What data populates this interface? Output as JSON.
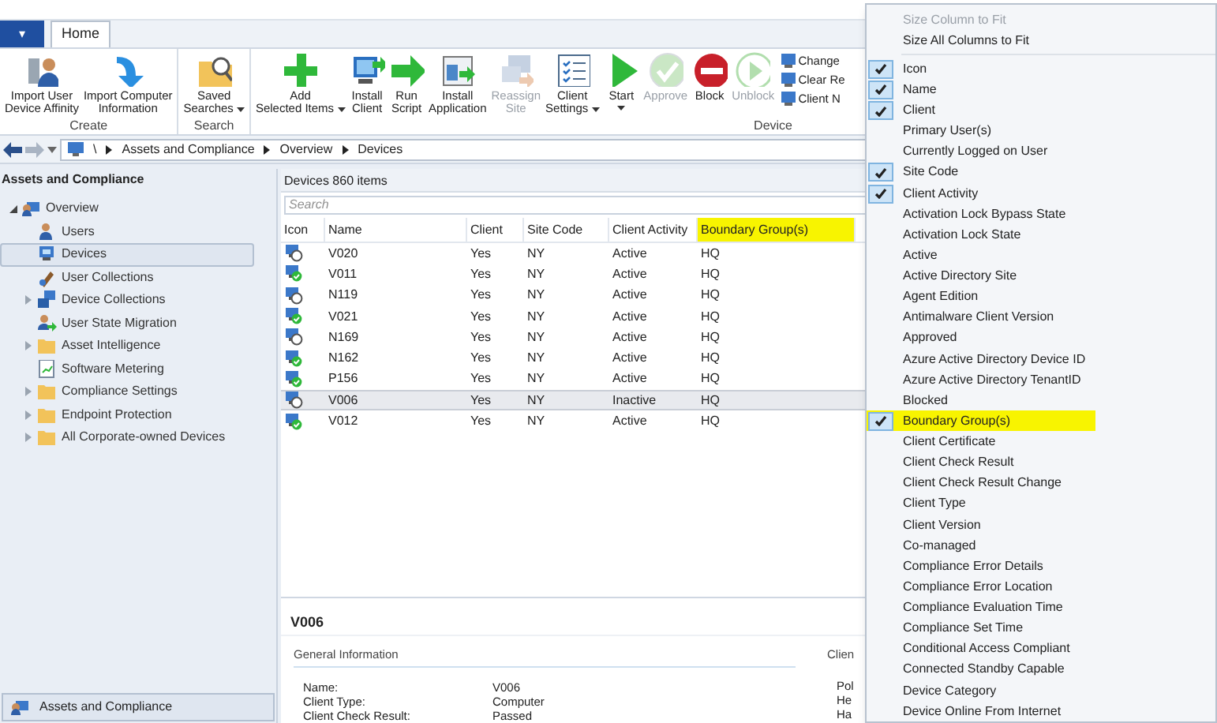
{
  "ribbon": {
    "menu_button": "▾",
    "tabs": [
      {
        "label": "Home",
        "selected": true
      }
    ],
    "groups": [
      {
        "label": "Create",
        "buttons": [
          {
            "kind": "affinity",
            "label": "Import User\nDevice Affinity",
            "disabled": false,
            "dropdown": false
          },
          {
            "kind": "import",
            "label": "Import Computer\nInformation",
            "disabled": false,
            "dropdown": false
          }
        ]
      },
      {
        "label": "Search",
        "buttons": [
          {
            "kind": "search",
            "label": "Saved\nSearches",
            "disabled": false,
            "dropdown": true
          }
        ]
      },
      {
        "label": "Device",
        "buttons": [
          {
            "kind": "add",
            "label": "Add\nSelected Items",
            "disabled": false,
            "dropdown": true
          },
          {
            "kind": "install",
            "label": "Install\nClient",
            "disabled": false,
            "dropdown": false
          },
          {
            "kind": "run",
            "label": "Run\nScript",
            "disabled": false,
            "dropdown": false
          },
          {
            "kind": "app",
            "label": "Install\nApplication",
            "disabled": false,
            "dropdown": false
          },
          {
            "kind": "reassign",
            "label": "Reassign\nSite",
            "disabled": true,
            "dropdown": false
          },
          {
            "kind": "settings",
            "label": "Client\nSettings",
            "disabled": false,
            "dropdown": true
          },
          {
            "kind": "start",
            "label": "Start",
            "disabled": false,
            "dropdown": true
          },
          {
            "kind": "approve",
            "label": "Approve",
            "disabled": true,
            "dropdown": false
          },
          {
            "kind": "block",
            "label": "Block",
            "disabled": false,
            "dropdown": false
          },
          {
            "kind": "unblock",
            "label": "Unblock",
            "disabled": true,
            "dropdown": false
          }
        ],
        "small_buttons": [
          "Change",
          "Clear Re",
          "Client N"
        ]
      }
    ]
  },
  "address_bar": {
    "path": [
      "\\",
      "Assets and Compliance",
      "Overview",
      "Devices"
    ]
  },
  "navigation": {
    "title": "Assets and Compliance",
    "tree": [
      {
        "label": "Overview",
        "kind": "overview",
        "expanded": true,
        "selected": false,
        "children": [
          {
            "label": "Users",
            "kind": "user",
            "selected": false
          },
          {
            "label": "Devices",
            "kind": "device",
            "selected": true
          },
          {
            "label": "User Collections",
            "kind": "user-collection",
            "selected": false
          },
          {
            "label": "Device Collections",
            "kind": "device-collection",
            "expanded": false,
            "selected": false
          },
          {
            "label": "User State Migration",
            "kind": "migration",
            "selected": false
          },
          {
            "label": "Asset Intelligence",
            "kind": "folder",
            "expanded": false,
            "selected": false
          },
          {
            "label": "Software Metering",
            "kind": "metering",
            "selected": false
          },
          {
            "label": "Compliance Settings",
            "kind": "folder",
            "expanded": false,
            "selected": false
          },
          {
            "label": "Endpoint Protection",
            "kind": "folder",
            "expanded": false,
            "selected": false
          },
          {
            "label": "All Corporate-owned Devices",
            "kind": "folder",
            "expanded": false,
            "selected": false
          }
        ]
      }
    ],
    "workspace": "Assets and Compliance"
  },
  "devices": {
    "title": "Devices 860 items",
    "search": {
      "placeholder": "Search"
    },
    "columns": [
      {
        "label": "Icon",
        "highlighted": false
      },
      {
        "label": "Name",
        "highlighted": false
      },
      {
        "label": "Client",
        "highlighted": false
      },
      {
        "label": "Site Code",
        "highlighted": false
      },
      {
        "label": "Client Activity",
        "highlighted": false
      },
      {
        "label": "Boundary Group(s)",
        "highlighted": true
      }
    ],
    "rows": [
      {
        "kind": "unchecked",
        "name": "V020",
        "client": "Yes",
        "site": "NY",
        "activity": "Active",
        "boundary": "HQ",
        "selected": false
      },
      {
        "kind": "checked",
        "name": "V011",
        "client": "Yes",
        "site": "NY",
        "activity": "Active",
        "boundary": "HQ",
        "selected": false
      },
      {
        "kind": "unchecked",
        "name": "N119",
        "client": "Yes",
        "site": "NY",
        "activity": "Active",
        "boundary": "HQ",
        "selected": false
      },
      {
        "kind": "checked",
        "name": "V021",
        "client": "Yes",
        "site": "NY",
        "activity": "Active",
        "boundary": "HQ",
        "selected": false
      },
      {
        "kind": "unchecked",
        "name": "N169",
        "client": "Yes",
        "site": "NY",
        "activity": "Active",
        "boundary": "HQ",
        "selected": false
      },
      {
        "kind": "checked",
        "name": "N162",
        "client": "Yes",
        "site": "NY",
        "activity": "Active",
        "boundary": "HQ",
        "selected": false
      },
      {
        "kind": "checked",
        "name": "P156",
        "client": "Yes",
        "site": "NY",
        "activity": "Active",
        "boundary": "HQ",
        "selected": false
      },
      {
        "kind": "unchecked",
        "name": "V006",
        "client": "Yes",
        "site": "NY",
        "activity": "Inactive",
        "boundary": "HQ",
        "selected": true
      },
      {
        "kind": "checked",
        "name": "V012",
        "client": "Yes",
        "site": "NY",
        "activity": "Active",
        "boundary": "HQ",
        "selected": false
      }
    ]
  },
  "details": {
    "title": "V006",
    "section": "General Information",
    "fields": [
      {
        "label": "Name:",
        "value": "V006"
      },
      {
        "label": "Client Type:",
        "value": "Computer"
      },
      {
        "label": "Client Check Result:",
        "value": "Passed"
      }
    ],
    "side_section": "Clien",
    "side_labels": [
      "Pol",
      "He",
      "Ha"
    ]
  },
  "context_menu": {
    "actions": [
      {
        "label": "Size Column to Fit",
        "disabled": true
      },
      {
        "label": "Size All Columns to Fit",
        "disabled": false
      }
    ],
    "columns": [
      {
        "label": "Icon",
        "checked": true,
        "highlighted": false
      },
      {
        "label": "Name",
        "checked": true,
        "highlighted": false
      },
      {
        "label": "Client",
        "checked": true,
        "highlighted": false
      },
      {
        "label": "Primary User(s)",
        "checked": false,
        "highlighted": false
      },
      {
        "label": "Currently Logged on User",
        "checked": false,
        "highlighted": false
      },
      {
        "label": "Site Code",
        "checked": true,
        "highlighted": false
      },
      {
        "label": "Client Activity",
        "checked": true,
        "highlighted": false
      },
      {
        "label": "Activation Lock Bypass State",
        "checked": false,
        "highlighted": false
      },
      {
        "label": "Activation Lock State",
        "checked": false,
        "highlighted": false
      },
      {
        "label": "Active",
        "checked": false,
        "highlighted": false
      },
      {
        "label": "Active Directory Site",
        "checked": false,
        "highlighted": false
      },
      {
        "label": "Agent Edition",
        "checked": false,
        "highlighted": false
      },
      {
        "label": "Antimalware Client Version",
        "checked": false,
        "highlighted": false
      },
      {
        "label": "Approved",
        "checked": false,
        "highlighted": false
      },
      {
        "label": "Azure Active Directory Device ID",
        "checked": false,
        "highlighted": false
      },
      {
        "label": "Azure Active Directory TenantID",
        "checked": false,
        "highlighted": false
      },
      {
        "label": "Blocked",
        "checked": false,
        "highlighted": false
      },
      {
        "label": "Boundary Group(s)",
        "checked": true,
        "highlighted": true
      },
      {
        "label": "Client Certificate",
        "checked": false,
        "highlighted": false
      },
      {
        "label": "Client Check Result",
        "checked": false,
        "highlighted": false
      },
      {
        "label": "Client Check Result Change",
        "checked": false,
        "highlighted": false
      },
      {
        "label": "Client Type",
        "checked": false,
        "highlighted": false
      },
      {
        "label": "Client Version",
        "checked": false,
        "highlighted": false
      },
      {
        "label": "Co-managed",
        "checked": false,
        "highlighted": false
      },
      {
        "label": "Compliance Error Details",
        "checked": false,
        "highlighted": false
      },
      {
        "label": "Compliance Error Location",
        "checked": false,
        "highlighted": false
      },
      {
        "label": "Compliance Evaluation Time",
        "checked": false,
        "highlighted": false
      },
      {
        "label": "Compliance Set Time",
        "checked": false,
        "highlighted": false
      },
      {
        "label": "Conditional Access Compliant",
        "checked": false,
        "highlighted": false
      },
      {
        "label": "Connected Standby Capable",
        "checked": false,
        "highlighted": false
      },
      {
        "label": "Device Category",
        "checked": false,
        "highlighted": false
      },
      {
        "label": "Device Online From Internet",
        "checked": false,
        "highlighted": false
      }
    ]
  }
}
